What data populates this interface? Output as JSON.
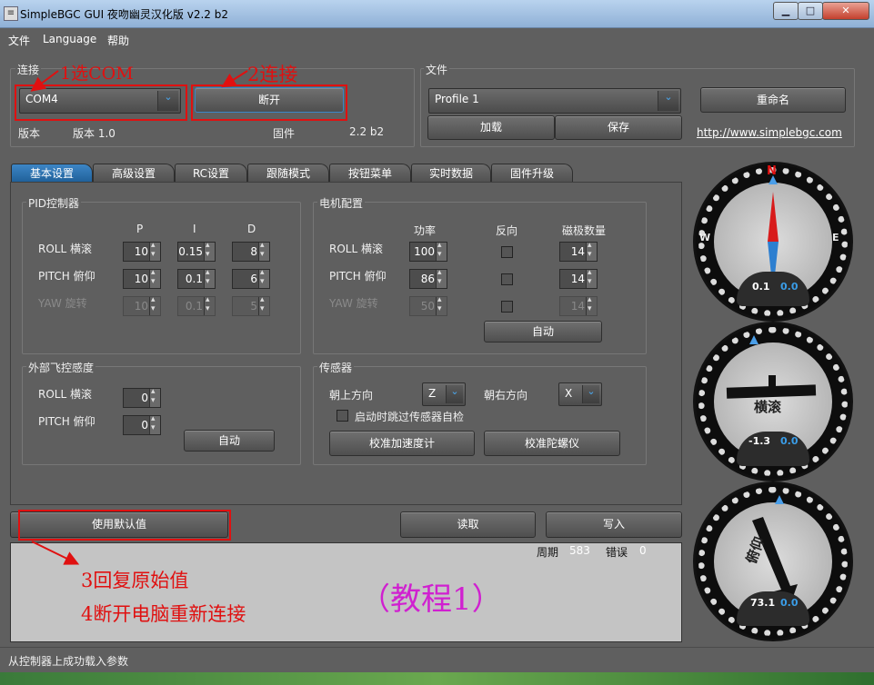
{
  "window": {
    "title": "SimpleBGC GUI 夜吻幽灵汉化版 v2.2 b2",
    "min": "▁",
    "max": "□",
    "close": "✕"
  },
  "menu": [
    "文件",
    "Language",
    "帮助"
  ],
  "connection": {
    "group_title": "连接",
    "port": "COM4",
    "connect_button": "断开",
    "version_label": "版本",
    "version_value": "版本 1.0",
    "firmware_label": "固件",
    "firmware_value": "2.2 b2"
  },
  "file": {
    "group_title": "文件",
    "profile": "Profile 1",
    "load_button": "加载",
    "save_button": "保存",
    "rename_button": "重命名",
    "link": "http://www.simplebgc.com"
  },
  "tabs": [
    "基本设置",
    "高级设置",
    "RC设置",
    "跟随模式",
    "按钮菜单",
    "实时数据",
    "固件升级"
  ],
  "pid": {
    "title": "PID控制器",
    "headers": [
      "P",
      "I",
      "D"
    ],
    "rows": [
      {
        "label": "ROLL 横滚",
        "p": "10",
        "i": "0.15",
        "d": "8"
      },
      {
        "label": "PITCH 俯仰",
        "p": "10",
        "i": "0.1",
        "d": "6"
      },
      {
        "label": "YAW 旋转",
        "p": "10",
        "i": "0.1",
        "d": "5"
      }
    ]
  },
  "motor": {
    "title": "电机配置",
    "headers": [
      "功率",
      "反向",
      "磁极数量"
    ],
    "rows": [
      {
        "label": "ROLL 横滚",
        "power": "100",
        "poles": "14"
      },
      {
        "label": "PITCH 俯仰",
        "power": "86",
        "poles": "14"
      },
      {
        "label": "YAW 旋转",
        "power": "50",
        "poles": "14"
      }
    ],
    "auto_button": "自动"
  },
  "external": {
    "title": "外部飞控感度",
    "rows": [
      {
        "label": "ROLL 横滚",
        "value": "0"
      },
      {
        "label": "PITCH 俯仰",
        "value": "0"
      }
    ],
    "auto_button": "自动"
  },
  "sensor": {
    "title": "传感器",
    "up_label": "朝上方向",
    "up_value": "Z",
    "right_label": "朝右方向",
    "right_value": "X",
    "skip_check": "启动时跳过传感器自检",
    "calib_acc": "校准加速度计",
    "calib_gyro": "校准陀螺仪"
  },
  "actions": {
    "defaults": "使用默认值",
    "read": "读取",
    "write": "写入"
  },
  "log": {
    "cycle_label": "周期",
    "cycle_value": "583",
    "error_label": "错误",
    "error_value": "0"
  },
  "status": "从控制器上成功载入参数",
  "annotations": {
    "a1": "1选COM",
    "a2": "2连接",
    "a3": "3回复原始值",
    "a4": "4断开电脑重新连接",
    "tutorial": "（教程1）"
  },
  "gauges": {
    "yaw": {
      "n": "N",
      "w": "W",
      "e": "E",
      "left": "0.1",
      "right": "0.0"
    },
    "roll": {
      "label": "横滚",
      "left": "-1.3",
      "right": "0.0"
    },
    "pitch": {
      "label": "俯仰",
      "left": "73.1",
      "right": "0.0"
    }
  },
  "colors": {
    "accent": "#3d86c6",
    "annotation": "#e01010",
    "tutorial": "#d020d0"
  }
}
